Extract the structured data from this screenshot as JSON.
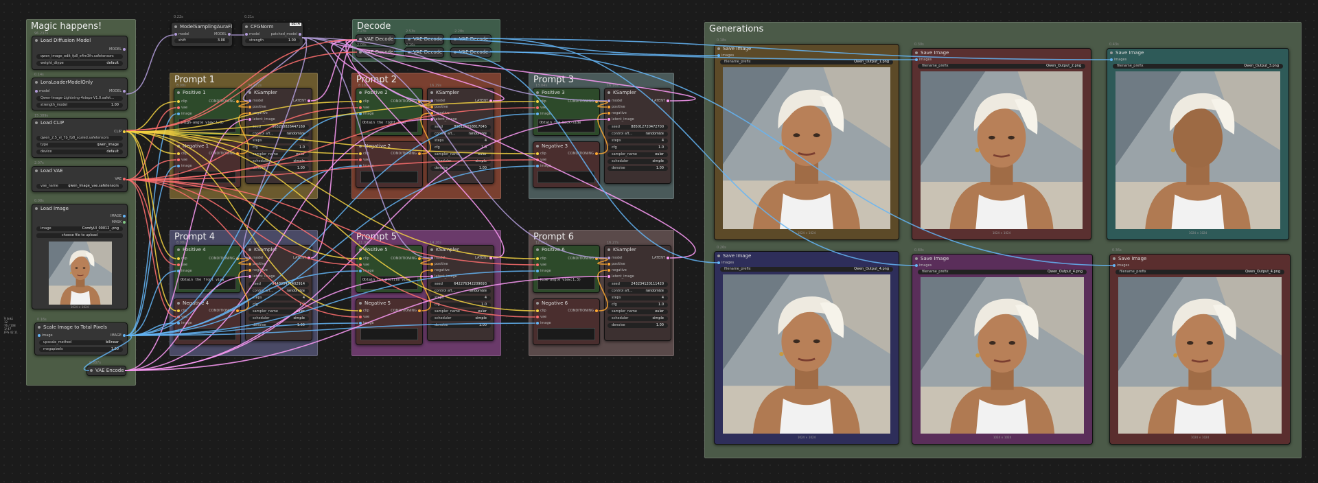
{
  "groups": {
    "magic": "Magic happens!",
    "decode": "Decode",
    "prompt1": "Prompt 1",
    "prompt2": "Prompt 2",
    "prompt3": "Prompt 3",
    "prompt4": "Prompt 4",
    "prompt5": "Prompt 5",
    "prompt6": "Prompt 6",
    "generations": "Generations"
  },
  "loaders": {
    "unet": {
      "title": "Load Diffusion Model",
      "tag": "96.237s",
      "out": "MODEL",
      "unet_name": "qwen_image_edit_fp8_e4m3fn.safetensors",
      "weight_dtype_label": "weight_dtype",
      "weight_dtype": "default"
    },
    "lora": {
      "title": "LoraLoaderModelOnly",
      "tag": "0.14s",
      "in": "model",
      "out": "MODEL",
      "lora_name": "Qwen-Image-Lightning-4steps-V1.0.safet...",
      "strength_label": "strength_model",
      "strength": "1.00"
    },
    "clip": {
      "title": "Load CLIP",
      "tag": "15.389s",
      "out": "CLIP",
      "clip_name": "qwen_2.5_vl_7b_fp8_scaled.safetensors",
      "type_label": "type",
      "type": "qwen_image",
      "device_label": "device",
      "device": "default"
    },
    "vae": {
      "title": "Load VAE",
      "tag": "2.07s",
      "out": "VAE",
      "vae_label": "vae_name",
      "vae_name": "qwen_image_vae.safetensors"
    },
    "image": {
      "title": "Load Image",
      "tag": "0.08s",
      "out1": "IMAGE",
      "out2": "MASK",
      "image_label": "image",
      "image": "ComfyUI_00012_.png",
      "upload": "choose file to upload",
      "dims": "1024 × 1024"
    },
    "scale": {
      "title": "Scale Image to Total Pixels",
      "tag": "0.16s",
      "in": "image",
      "out": "IMAGE",
      "method_label": "upscale_method",
      "method": "bilinear",
      "mp_label": "megapixels",
      "mp": "1.00"
    },
    "encode": {
      "title": "VAE Encode",
      "tag": "0.887s"
    }
  },
  "side_note": [
    "9 links",
    "12",
    "76 / 108",
    "1/ 47",
    "FPS 42.11"
  ],
  "top_nodes": {
    "sampling": {
      "title": "ModelSamplingAuraFl...",
      "tag": "0.22s",
      "in": "model",
      "out": "MODEL",
      "shift_label": "shift",
      "shift": "3.00"
    },
    "cfg": {
      "title": "CFGNorm",
      "tag": "0.21s",
      "beta": "BETA",
      "in": "model",
      "out": "patched_model",
      "strength_label": "strength",
      "strength": "1.00"
    }
  },
  "decode_nodes": [
    {
      "title": "VAE Decode",
      "tag": "2.23s"
    },
    {
      "title": "VAE Decode",
      "tag": "2.08s"
    },
    {
      "title": "VAE Decode",
      "tag": "2.53s"
    },
    {
      "title": "VAE Decode",
      "tag": "2.16s"
    },
    {
      "title": "VAE Decode",
      "tag": "2.28s"
    },
    {
      "title": "VAE Decode",
      "tag": ""
    }
  ],
  "labels": {
    "conditioning": "CONDITIONING",
    "clip": "clip",
    "vae": "vae",
    "image": "image",
    "ksampler": "KSampler",
    "latent": "LATENT",
    "model": "model",
    "positive": "positive",
    "negative": "negative",
    "latent_image": "latent_image",
    "seed": "seed",
    "control": "control aft...",
    "steps": "steps",
    "cfg": "cfg",
    "sampler": "sampler_name",
    "scheduler": "scheduler",
    "denoise": "denoise"
  },
  "prompts": [
    {
      "pos_title": "Positive 1",
      "pos_tag": "8.08s",
      "neg_title": "Negative 1",
      "ks_tag": "94.472s",
      "text": "(High-angle view:1.3)",
      "seed": "963290826447169",
      "control": "randomize",
      "steps": "4",
      "cfg": "1.0",
      "sampler": "euler",
      "scheduler": "simple",
      "denoise": "1.00"
    },
    {
      "pos_title": "Positive 2",
      "pos_tag": "8.16s",
      "neg_title": "Negative 2",
      "ks_tag": "16.29s",
      "text": "Obtain the right-side",
      "seed": "898126658817045",
      "control": "randomize",
      "steps": "4",
      "cfg": "1.0",
      "sampler": "euler",
      "scheduler": "simple",
      "denoise": "1.00"
    },
    {
      "pos_title": "Positive 3",
      "pos_tag": "13.04s",
      "neg_title": "Negative 3",
      "ks_tag": "16.16s",
      "text": "Obtain the back-side",
      "seed": "885012720472700",
      "control": "randomize",
      "steps": "4",
      "cfg": "1.0",
      "sampler": "euler",
      "scheduler": "simple",
      "denoise": "1.00"
    },
    {
      "pos_title": "Positive 4",
      "pos_tag": "8.08s",
      "neg_title": "Negative 4",
      "ks_tag": "15.96s",
      "text": "Obtain the front view",
      "seed": "944805437402914",
      "control": "randomize",
      "steps": "4",
      "cfg": "1.0",
      "sampler": "euler",
      "scheduler": "simple",
      "denoise": "1.00"
    },
    {
      "pos_title": "Positive 5",
      "pos_tag": "11.99s",
      "neg_title": "Negative 5",
      "ks_tag": "14.26s",
      "text": "Obtain the profile view",
      "seed": "642276342209693",
      "control": "randomize",
      "steps": "4",
      "cfg": "1.0",
      "sampler": "euler",
      "scheduler": "simple",
      "denoise": "1.00"
    },
    {
      "pos_title": "Positive 6",
      "pos_tag": "12.61s",
      "neg_title": "Negative 6",
      "ks_tag": "16.27s",
      "text": "(Low-angle view:1.3)",
      "seed": "243234120111420",
      "control": "randomize",
      "steps": "4",
      "cfg": "1.0",
      "sampler": "euler",
      "scheduler": "simple",
      "denoise": "1.00"
    }
  ],
  "saves": [
    {
      "title": "Save Image",
      "tag": "0.18s",
      "prefix_label": "filename_prefix",
      "prefix": "Qwen_Output_1.png",
      "in": "images",
      "dims": "1024 × 1024"
    },
    {
      "title": "Save Image",
      "tag": "0.30s",
      "prefix_label": "filename_prefix",
      "prefix": "Qwen_Output_2.png",
      "in": "images",
      "dims": "1024 × 1024"
    },
    {
      "title": "Save Image",
      "tag": "0.43s",
      "prefix_label": "filename_prefix",
      "prefix": "Qwen_Output_3.png",
      "in": "images",
      "dims": "1024 × 1024"
    },
    {
      "title": "Save Image",
      "tag": "0.26s",
      "prefix_label": "filename_prefix",
      "prefix": "Qwen_Output_4.png",
      "in": "images",
      "dims": "1024 × 1024"
    },
    {
      "title": "Save Image",
      "tag": "0.80s",
      "prefix_label": "filename_prefix",
      "prefix": "Qwen_Output_4.png",
      "in": "images",
      "dims": "1024 × 1024"
    },
    {
      "title": "Save Image",
      "tag": "0.36s",
      "prefix_label": "filename_prefix",
      "prefix": "Qwen_Output_4.png",
      "in": "images",
      "dims": "1024 × 1024"
    }
  ],
  "colors": {
    "clip": "#f5d442",
    "vae": "#ff6e6e",
    "model": "#b39ddb",
    "latent": "#ff9cf9",
    "image": "#64b5f6",
    "conditioning": "#ffa931"
  }
}
